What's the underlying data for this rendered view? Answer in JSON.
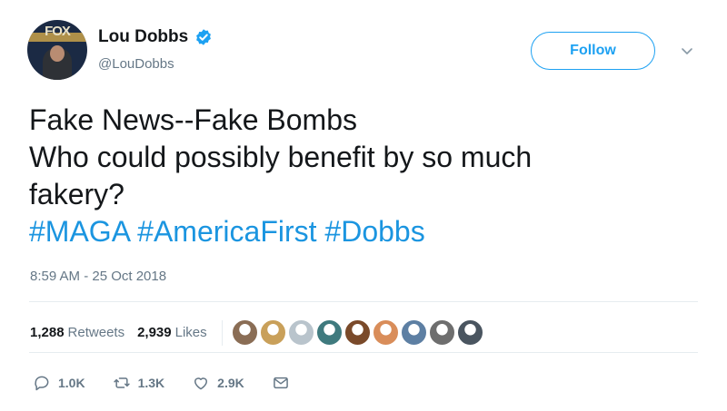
{
  "user": {
    "display_name": "Lou Dobbs",
    "handle": "@LouDobbs",
    "avatar_logo_text": "FOX",
    "verified": true,
    "verified_color": "#1da1f2"
  },
  "header": {
    "follow_label": "Follow",
    "caret_icon": "chevron-down-icon"
  },
  "tweet": {
    "lines": [
      "Fake News--Fake Bombs",
      "Who could possibly benefit by so much",
      "fakery?"
    ],
    "hashtags": [
      "#MAGA",
      "#AmericaFirst",
      "#Dobbs"
    ],
    "hashtag_color": "#1b95e0",
    "timestamp": "8:59 AM - 25 Oct 2018"
  },
  "stats": {
    "retweets_count": "1,288",
    "retweets_label": "Retweets",
    "likes_count": "2,939",
    "likes_label": "Likes",
    "liker_avatar_colors": [
      "#8a6d55",
      "#c9a05a",
      "#b9c4cc",
      "#3f7a7e",
      "#7a4a2a",
      "#d98d5a",
      "#5d7fa3",
      "#6e6e6e",
      "#4a5560"
    ]
  },
  "actions": {
    "replies": "1.0K",
    "retweets": "1.3K",
    "likes": "2.9K",
    "icons": [
      "reply-icon",
      "retweet-icon",
      "heart-icon",
      "message-icon"
    ]
  }
}
